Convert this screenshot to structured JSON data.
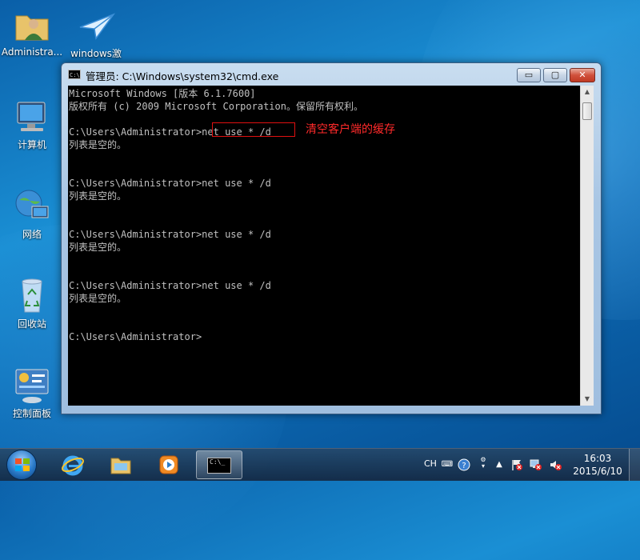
{
  "desktop": {
    "icons": [
      {
        "label": "Administra...",
        "icon": "user-folder-icon"
      },
      {
        "label": "windows激",
        "icon": "paper-plane-icon"
      },
      {
        "label": "计算机",
        "icon": "computer-icon"
      },
      {
        "label": "网络",
        "icon": "network-globe-icon"
      },
      {
        "label": "回收站",
        "icon": "recycle-bin-icon"
      },
      {
        "label": "控制面板",
        "icon": "control-panel-icon"
      }
    ]
  },
  "window": {
    "title": "管理员: C:\\Windows\\system32\\cmd.exe",
    "title_icon": "C:\\",
    "buttons": {
      "minimize": "▭",
      "maximize": "▢",
      "close": "✕"
    },
    "console_lines": [
      "Microsoft Windows [版本 6.1.7600]",
      "版权所有 (c) 2009 Microsoft Corporation。保留所有权利。",
      "",
      "C:\\Users\\Administrator>net use * /d",
      "列表是空的。",
      "",
      "",
      "C:\\Users\\Administrator>net use * /d",
      "列表是空的。",
      "",
      "",
      "C:\\Users\\Administrator>net use * /d",
      "列表是空的。",
      "",
      "",
      "C:\\Users\\Administrator>net use * /d",
      "列表是空的。",
      "",
      "",
      "C:\\Users\\Administrator>"
    ],
    "annotation": "清空客户端的缓存",
    "scroll_up": "▲",
    "scroll_down": "▼"
  },
  "taskbar": {
    "cmd_label": "C:\\_",
    "tray": {
      "language": "CH"
    },
    "clock": {
      "time": "16:03",
      "date": "2015/6/10"
    }
  },
  "colors": {
    "console_bg": "#000000",
    "console_fg": "#c0c0c0",
    "annotation": "#ff2a2a"
  }
}
